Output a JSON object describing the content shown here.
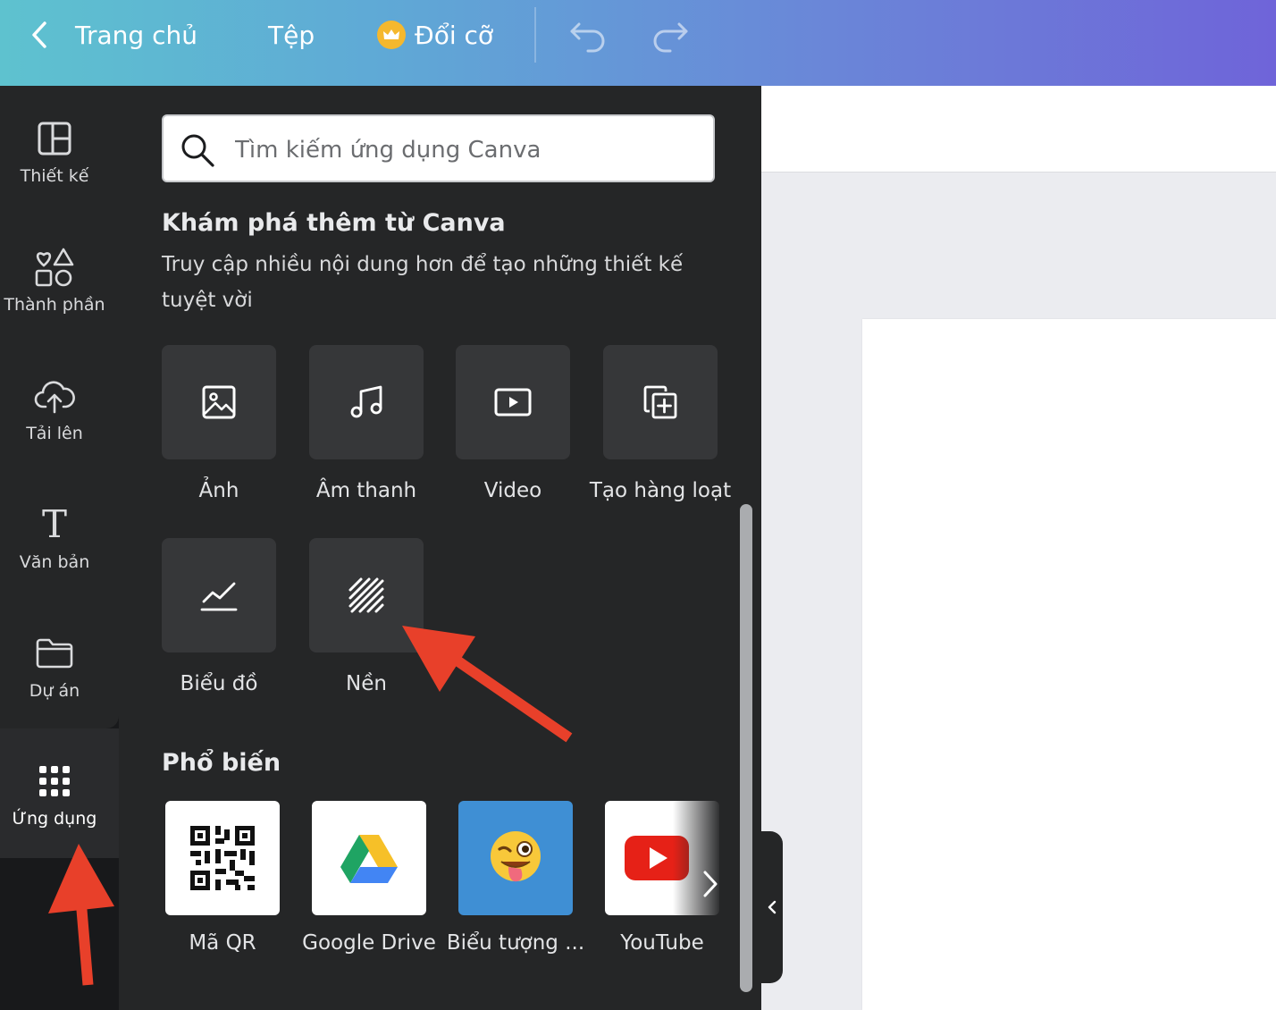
{
  "topbar": {
    "home_label": "Trang chủ",
    "file_label": "Tệp",
    "resize_label": "Đổi cỡ"
  },
  "rail": {
    "items": [
      {
        "label": "Thiết kế",
        "icon": "layout-icon"
      },
      {
        "label": "Thành phần",
        "icon": "shapes-icon"
      },
      {
        "label": "Tải lên",
        "icon": "cloud-upload-icon"
      },
      {
        "label": "Văn bản",
        "icon": "text-icon"
      },
      {
        "label": "Dự án",
        "icon": "folder-icon"
      },
      {
        "label": "Ứng dụng",
        "icon": "apps-grid-icon",
        "active": true
      }
    ]
  },
  "panel": {
    "search_placeholder": "Tìm kiếm ứng dụng Canva",
    "explore_title": "Khám phá thêm từ Canva",
    "explore_desc": "Truy cập nhiều nội dung hơn để tạo những thiết kế tuyệt vời",
    "tiles": [
      {
        "label": "Ảnh",
        "icon": "image-icon"
      },
      {
        "label": "Âm thanh",
        "icon": "music-icon"
      },
      {
        "label": "Video",
        "icon": "video-icon"
      },
      {
        "label": "Tạo hàng loạt",
        "icon": "bulk-create-icon"
      },
      {
        "label": "Biểu đồ",
        "icon": "chart-icon"
      },
      {
        "label": "Nền",
        "icon": "background-pattern-icon"
      }
    ],
    "popular_title": "Phổ biến",
    "apps": [
      {
        "label": "Mã QR",
        "icon": "qr-code-icon"
      },
      {
        "label": "Google Drive",
        "icon": "google-drive-icon"
      },
      {
        "label": "Biểu tượng ...",
        "icon": "emoji-icon"
      },
      {
        "label": "YouTube",
        "icon": "youtube-icon"
      }
    ]
  },
  "colors": {
    "panel_bg": "#252627",
    "rail_bg": "#18191b",
    "accent_arrow": "#e8402a",
    "topbar_start": "#5ec2cf",
    "topbar_end": "#6f64d9"
  }
}
